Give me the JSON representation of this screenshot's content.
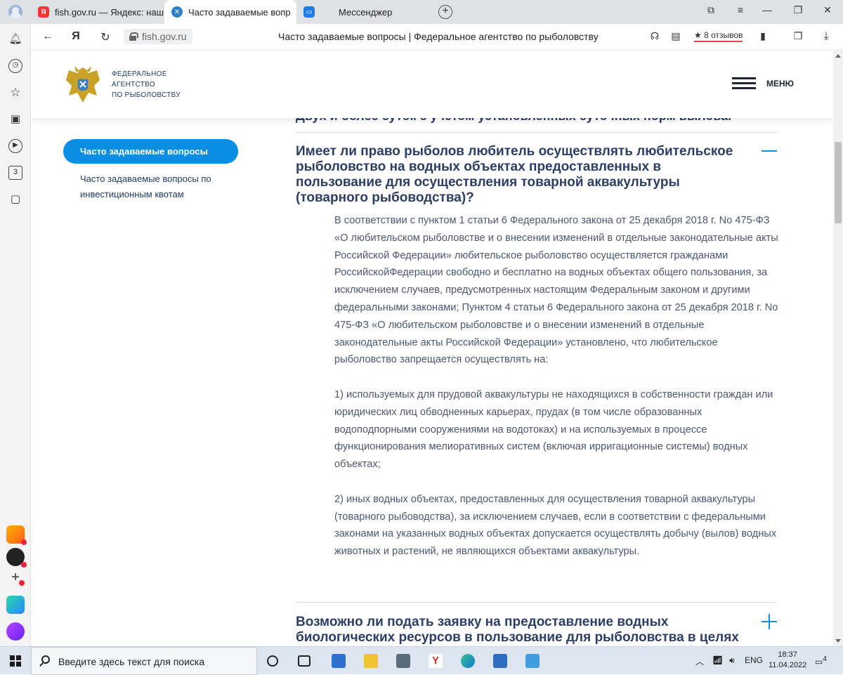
{
  "browser": {
    "tabs": [
      {
        "title": "fish.gov.ru — Яндекс: наш",
        "icon": "yandex-icon",
        "active": false
      },
      {
        "title": "Часто задаваемые вопр",
        "icon": "fishgov-icon",
        "active": true
      },
      {
        "title": "Мессенджер",
        "icon": "messenger-icon",
        "active": false
      }
    ],
    "url": "fish.gov.ru",
    "page_title": "Часто задаваемые вопросы | Федеральное агентство по рыболовству",
    "reviews": "★ 8 отзывов"
  },
  "site": {
    "org_name": [
      "ФЕДЕРАЛЬНОЕ",
      "АГЕНТСТВО",
      "ПО РЫБОЛОВСТВУ"
    ],
    "menu_label": "МЕНЮ",
    "accent_color": "#0a8ee4",
    "heading_color": "#2c3e66"
  },
  "sidenav": {
    "active": "Часто задаваемые вопросы",
    "items": [
      "Часто задаваемые вопросы по инвестиционным квотам"
    ]
  },
  "faq": {
    "cutoff_text": "Двух и более суток с учетом установленных суточных норм вылова.",
    "q1": "Имеет ли право рыболов любитель осуществлять любительское рыболовство на водных объектах предоставленных в пользование для осуществления товарной аквакультуры (товарного рыбоводства)?",
    "a1": [
      "В соответствии с пунктом 1 статьи 6 Федерального закона от 25 декабря 2018 г. No 475-ФЗ «О любительском рыболовстве и о внесении изменений в отдельные законодательные акты Российской Федерации» любительское рыболовство осуществляется гражданами РоссийскойФедерации свободно и бесплатно на водных объектах общего пользования, за исключением случаев, предусмотренных настоящим Федеральным законом и другими федеральными законами; Пунктом 4 статьи 6 Федерального закона от 25 декабря 2018 г. No 475-ФЗ «О любительском рыболовстве и о внесении изменений в отдельные законодательные акты Российской Федерации» установлено, что любительское рыболовство запрещается осуществлять на:",
      "1) используемых для прудовой аквакультуры не находящихся в собственности граждан или юридических лиц обводненных карьерах, прудах (в том числе образованных водоподпорными сооружениями на водотоках) и на используемых в процессе функционирования мелиоративных систем (включая ирригационные системы) водных объектах;",
      "2) иных водных объектах, предоставленных для осуществления товарной аквакультуры (товарного рыбоводства), за исключением случаев, если в соответствии с федеральными законами на указанных водных объектах допускается осуществлять добычу (вылов) водных животных и растений, не являющихся объектами аквакультуры."
    ],
    "q2": "Возможно ли подать заявку на предоставление водных биологических ресурсов в пользование для рыболовства в целях обеспечения"
  },
  "taskbar": {
    "search_placeholder": "Введите здесь текст для поиска",
    "lang": "ENG",
    "time": "18:37",
    "date": "11.04.2022",
    "notifications": "4"
  }
}
